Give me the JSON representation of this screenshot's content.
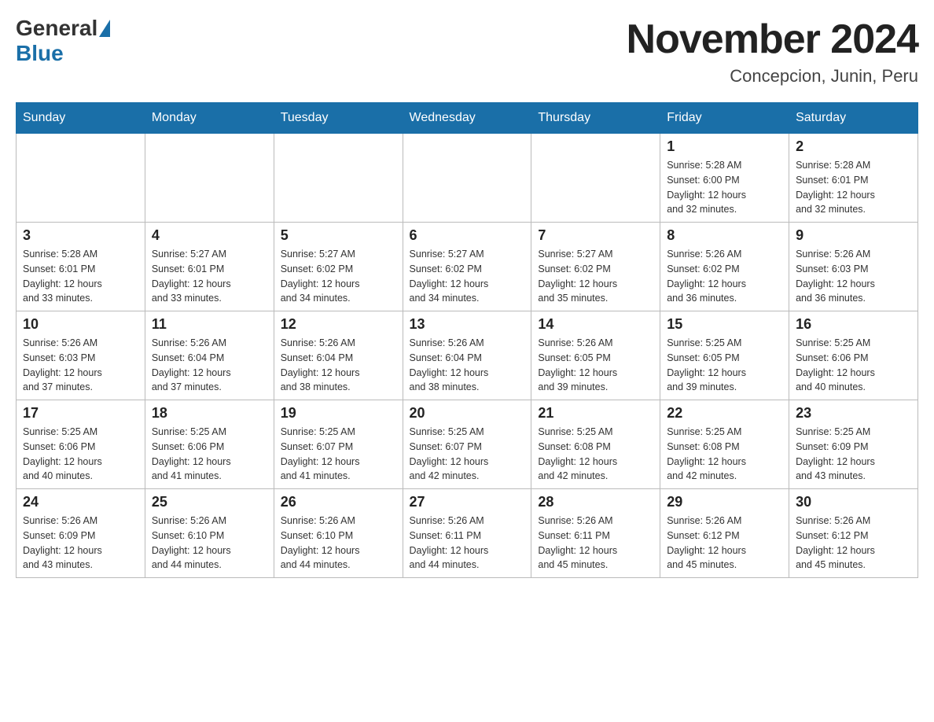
{
  "header": {
    "logo": {
      "general": "General",
      "blue": "Blue"
    },
    "title": "November 2024",
    "subtitle": "Concepcion, Junin, Peru"
  },
  "weekdays": [
    "Sunday",
    "Monday",
    "Tuesday",
    "Wednesday",
    "Thursday",
    "Friday",
    "Saturday"
  ],
  "weeks": [
    [
      {
        "day": "",
        "info": ""
      },
      {
        "day": "",
        "info": ""
      },
      {
        "day": "",
        "info": ""
      },
      {
        "day": "",
        "info": ""
      },
      {
        "day": "",
        "info": ""
      },
      {
        "day": "1",
        "info": "Sunrise: 5:28 AM\nSunset: 6:00 PM\nDaylight: 12 hours\nand 32 minutes."
      },
      {
        "day": "2",
        "info": "Sunrise: 5:28 AM\nSunset: 6:01 PM\nDaylight: 12 hours\nand 32 minutes."
      }
    ],
    [
      {
        "day": "3",
        "info": "Sunrise: 5:28 AM\nSunset: 6:01 PM\nDaylight: 12 hours\nand 33 minutes."
      },
      {
        "day": "4",
        "info": "Sunrise: 5:27 AM\nSunset: 6:01 PM\nDaylight: 12 hours\nand 33 minutes."
      },
      {
        "day": "5",
        "info": "Sunrise: 5:27 AM\nSunset: 6:02 PM\nDaylight: 12 hours\nand 34 minutes."
      },
      {
        "day": "6",
        "info": "Sunrise: 5:27 AM\nSunset: 6:02 PM\nDaylight: 12 hours\nand 34 minutes."
      },
      {
        "day": "7",
        "info": "Sunrise: 5:27 AM\nSunset: 6:02 PM\nDaylight: 12 hours\nand 35 minutes."
      },
      {
        "day": "8",
        "info": "Sunrise: 5:26 AM\nSunset: 6:02 PM\nDaylight: 12 hours\nand 36 minutes."
      },
      {
        "day": "9",
        "info": "Sunrise: 5:26 AM\nSunset: 6:03 PM\nDaylight: 12 hours\nand 36 minutes."
      }
    ],
    [
      {
        "day": "10",
        "info": "Sunrise: 5:26 AM\nSunset: 6:03 PM\nDaylight: 12 hours\nand 37 minutes."
      },
      {
        "day": "11",
        "info": "Sunrise: 5:26 AM\nSunset: 6:04 PM\nDaylight: 12 hours\nand 37 minutes."
      },
      {
        "day": "12",
        "info": "Sunrise: 5:26 AM\nSunset: 6:04 PM\nDaylight: 12 hours\nand 38 minutes."
      },
      {
        "day": "13",
        "info": "Sunrise: 5:26 AM\nSunset: 6:04 PM\nDaylight: 12 hours\nand 38 minutes."
      },
      {
        "day": "14",
        "info": "Sunrise: 5:26 AM\nSunset: 6:05 PM\nDaylight: 12 hours\nand 39 minutes."
      },
      {
        "day": "15",
        "info": "Sunrise: 5:25 AM\nSunset: 6:05 PM\nDaylight: 12 hours\nand 39 minutes."
      },
      {
        "day": "16",
        "info": "Sunrise: 5:25 AM\nSunset: 6:06 PM\nDaylight: 12 hours\nand 40 minutes."
      }
    ],
    [
      {
        "day": "17",
        "info": "Sunrise: 5:25 AM\nSunset: 6:06 PM\nDaylight: 12 hours\nand 40 minutes."
      },
      {
        "day": "18",
        "info": "Sunrise: 5:25 AM\nSunset: 6:06 PM\nDaylight: 12 hours\nand 41 minutes."
      },
      {
        "day": "19",
        "info": "Sunrise: 5:25 AM\nSunset: 6:07 PM\nDaylight: 12 hours\nand 41 minutes."
      },
      {
        "day": "20",
        "info": "Sunrise: 5:25 AM\nSunset: 6:07 PM\nDaylight: 12 hours\nand 42 minutes."
      },
      {
        "day": "21",
        "info": "Sunrise: 5:25 AM\nSunset: 6:08 PM\nDaylight: 12 hours\nand 42 minutes."
      },
      {
        "day": "22",
        "info": "Sunrise: 5:25 AM\nSunset: 6:08 PM\nDaylight: 12 hours\nand 42 minutes."
      },
      {
        "day": "23",
        "info": "Sunrise: 5:25 AM\nSunset: 6:09 PM\nDaylight: 12 hours\nand 43 minutes."
      }
    ],
    [
      {
        "day": "24",
        "info": "Sunrise: 5:26 AM\nSunset: 6:09 PM\nDaylight: 12 hours\nand 43 minutes."
      },
      {
        "day": "25",
        "info": "Sunrise: 5:26 AM\nSunset: 6:10 PM\nDaylight: 12 hours\nand 44 minutes."
      },
      {
        "day": "26",
        "info": "Sunrise: 5:26 AM\nSunset: 6:10 PM\nDaylight: 12 hours\nand 44 minutes."
      },
      {
        "day": "27",
        "info": "Sunrise: 5:26 AM\nSunset: 6:11 PM\nDaylight: 12 hours\nand 44 minutes."
      },
      {
        "day": "28",
        "info": "Sunrise: 5:26 AM\nSunset: 6:11 PM\nDaylight: 12 hours\nand 45 minutes."
      },
      {
        "day": "29",
        "info": "Sunrise: 5:26 AM\nSunset: 6:12 PM\nDaylight: 12 hours\nand 45 minutes."
      },
      {
        "day": "30",
        "info": "Sunrise: 5:26 AM\nSunset: 6:12 PM\nDaylight: 12 hours\nand 45 minutes."
      }
    ]
  ]
}
